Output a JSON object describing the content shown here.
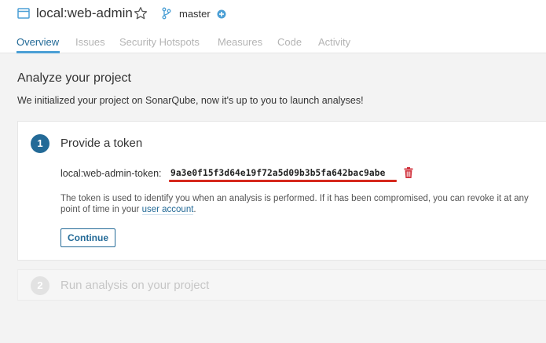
{
  "header": {
    "project_name": "local:web-admin",
    "branch": "master",
    "tabs": [
      {
        "label": "Overview",
        "active": true
      },
      {
        "label": "Issues",
        "active": false
      },
      {
        "label": "Security Hotspots",
        "active": false
      },
      {
        "label": "Measures",
        "active": false
      },
      {
        "label": "Code",
        "active": false
      },
      {
        "label": "Activity",
        "active": false
      }
    ]
  },
  "main": {
    "title": "Analyze your project",
    "subtitle": "We initialized your project on SonarQube, now it's up to you to launch analyses!",
    "step1": {
      "number": "1",
      "title": "Provide a token",
      "token_label": "local:web-admin-token:",
      "token_value": "9a3e0f15f3d64e19f72a5d09b3b5fa642bac9abe",
      "help_text": "The token is used to identify you when an analysis is performed. If it has been compromised, you can revoke it at any point of time in your ",
      "help_link": "user account",
      "help_end": ".",
      "continue_label": "Continue"
    },
    "step2": {
      "number": "2",
      "title": "Run analysis on your project"
    }
  },
  "colors": {
    "accent": "#236a97",
    "tab_underline": "#4b9fd5",
    "token_highlight": "#d6281d",
    "delete": "#d02f3a"
  },
  "icons": {
    "project": "project-icon",
    "favorite": "star-icon",
    "branch": "branch-icon",
    "add": "plus-circle-icon",
    "delete": "trash-icon"
  }
}
